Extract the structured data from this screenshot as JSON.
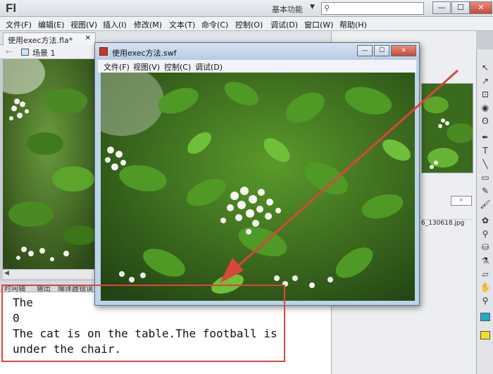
{
  "app": {
    "logo": "Fl",
    "workspace": "基本功能",
    "workspace_caret": "▼",
    "search_icon": "magnifier-icon",
    "window_controls": {
      "minimize": "—",
      "maximize": "☐",
      "close": "✕"
    }
  },
  "menubar": {
    "items": [
      "文件(F)",
      "编辑(E)",
      "视图(V)",
      "插入(I)",
      "修改(M)",
      "文本(T)",
      "命令(C)",
      "控制(O)",
      "调试(D)",
      "窗口(W)",
      "帮助(H)"
    ]
  },
  "document_tab": {
    "label": "使用exec方法.fla*",
    "close": "✕"
  },
  "breadcrumb": {
    "back": "←",
    "scene": "场景 1"
  },
  "panel_tabs": [
    "时间轴",
    "输出",
    "编译器错误"
  ],
  "output": {
    "lines": [
      "The",
      "0",
      "The cat is on the table.The football is",
      "under the chair."
    ]
  },
  "swf_window": {
    "title": "使用exec方法.swf",
    "menu": [
      "文件(F)",
      "视图(V)",
      "控制(C)",
      "调试(D)"
    ],
    "controls": {
      "minimize": "—",
      "maximize": "☐",
      "close": "✕"
    }
  },
  "library": {
    "search_glyph": "⌕",
    "file_name": "6_130618.jpg"
  },
  "toolbar": {
    "tools": [
      {
        "icon": "selection-arrow-icon",
        "glyph": "↖"
      },
      {
        "icon": "subselection-icon",
        "glyph": "↗"
      },
      {
        "icon": "free-transform-icon",
        "glyph": "⊡"
      },
      {
        "icon": "3d-rotation-icon",
        "glyph": "◉"
      },
      {
        "icon": "lasso-icon",
        "glyph": "ʘ"
      },
      {
        "icon": "pen-icon",
        "glyph": "✒"
      },
      {
        "icon": "text-icon",
        "glyph": "T"
      },
      {
        "icon": "line-icon",
        "glyph": "╲"
      },
      {
        "icon": "rectangle-icon",
        "glyph": "▭"
      },
      {
        "icon": "pencil-icon",
        "glyph": "✎"
      },
      {
        "icon": "brush-icon",
        "glyph": "🖌"
      },
      {
        "icon": "deco-icon",
        "glyph": "✿"
      },
      {
        "icon": "bone-icon",
        "glyph": "⚲"
      },
      {
        "icon": "paint-bucket-icon",
        "glyph": "⛁"
      },
      {
        "icon": "eyedropper-icon",
        "glyph": "⚗"
      },
      {
        "icon": "eraser-icon",
        "glyph": "▱"
      },
      {
        "icon": "hand-icon",
        "glyph": "✋"
      },
      {
        "icon": "zoom-icon",
        "glyph": "⚲"
      }
    ],
    "stroke_color": "#22aacc",
    "fill_color": "#f0e020"
  },
  "colors": {
    "highlight": "#d9463c",
    "arrow": "#d9463c"
  }
}
